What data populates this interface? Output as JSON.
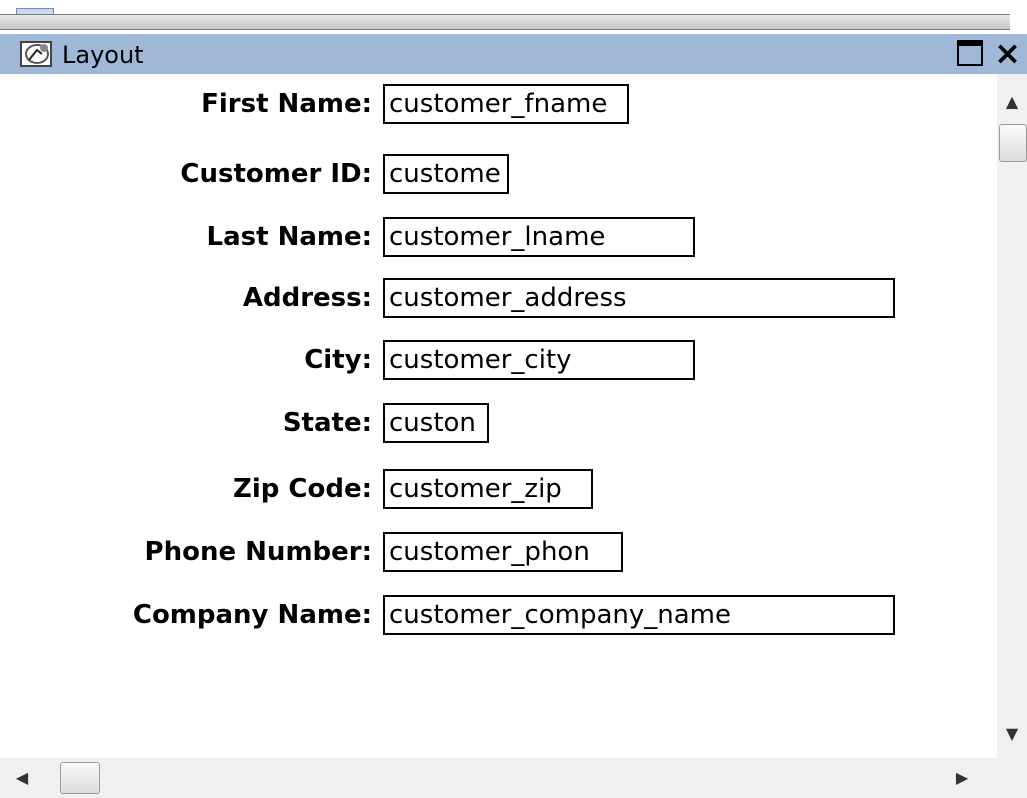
{
  "window": {
    "title": "Layout",
    "icon": "layout-window-icon",
    "maximize_icon": "maximize-icon",
    "close_glyph": "×"
  },
  "form": {
    "fields": [
      {
        "label": "First Name:",
        "value": "customer_fname"
      },
      {
        "label": "Customer ID:",
        "value": "custome"
      },
      {
        "label": "Last Name:",
        "value": "customer_lname"
      },
      {
        "label": "Address:",
        "value": "customer_address"
      },
      {
        "label": "City:",
        "value": "customer_city"
      },
      {
        "label": "State:",
        "value": "custon"
      },
      {
        "label": "Zip Code:",
        "value": "customer_zip"
      },
      {
        "label": "Phone Number:",
        "value": "customer_phon"
      },
      {
        "label": "Company Name:",
        "value": "customer_company_name"
      }
    ]
  },
  "scrollbars": {
    "up_glyph": "▲",
    "down_glyph": "▼",
    "left_glyph": "◀",
    "right_glyph": "▶"
  },
  "colors": {
    "titlebar": "#9fb8d8",
    "field_border": "#000000"
  }
}
